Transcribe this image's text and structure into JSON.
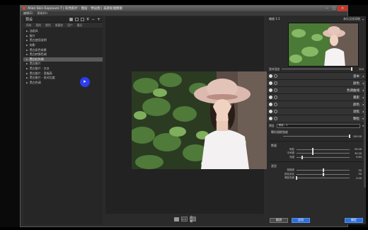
{
  "window": {
    "title": "Alien Skin Exposure 7 | 彩色胶片 - 图层 - 预设图 | 美颜处理模版"
  },
  "menubar": [
    "编辑(E)",
    "帮助(H)"
  ],
  "left_panel": {
    "title": "预设",
    "tabs": [
      "所有",
      "我的",
      "颜色",
      "收藏夹",
      "用户",
      "最近"
    ],
    "items": [
      {
        "label": "油画风",
        "selected": false
      },
      {
        "label": "胶片",
        "selected": false
      },
      {
        "label": "黑白使用说明",
        "selected": false
      },
      {
        "label": "电影",
        "selected": false
      },
      {
        "label": "黑白彩色效果",
        "selected": false
      },
      {
        "label": "黑白转换色调",
        "selected": false
      },
      {
        "label": "黑白红外线",
        "selected": true
      },
      {
        "label": "黑白胶片",
        "selected": false
      },
      {
        "label": "黑白胶片 - 交叉",
        "selected": false
      },
      {
        "label": "黑白胶片 - 宽幅高",
        "selected": false
      },
      {
        "label": "黑白胶片 - 低对比度",
        "selected": false
      },
      {
        "label": "黑白色调",
        "selected": false
      }
    ]
  },
  "center": {
    "zoom_button": "1:1",
    "compare_button": "之前"
  },
  "right_panel": {
    "zoom": "缩放 1:1",
    "preset_name": "永乐汉化导航",
    "overall_label": "整体强度",
    "overall_value": "100",
    "overall_fraction": 1.0,
    "sections": [
      {
        "label": "基本",
        "dot": "filled"
      },
      {
        "label": "颜色",
        "dot": "filled"
      },
      {
        "label": "色调曲线",
        "dot": "filled"
      },
      {
        "label": "暴影",
        "dot": "filled"
      },
      {
        "label": "颜色",
        "dot": "filled"
      },
      {
        "label": "调焦",
        "dot": "filled"
      },
      {
        "label": "颗粒",
        "dot": "filled"
      }
    ],
    "grain": {
      "preset_label": "预设",
      "preset_value": "预设 - 1",
      "strength_label": "颗粒粗糙强度",
      "strength_value": "100.00",
      "strength_fraction": 1.0,
      "amount_title": "数量",
      "amount_rows": [
        {
          "label": "阴影",
          "value": "30.00",
          "fraction": 0.3
        },
        {
          "label": "中间调",
          "value": "30.00",
          "fraction": 0.3
        },
        {
          "label": "亮度",
          "value": "9.84",
          "fraction": 0.1
        }
      ],
      "type_title": "类型",
      "type_rows": [
        {
          "label": "粗糙度",
          "value": "50",
          "fraction": 0.5
        },
        {
          "label": "颜色变化",
          "value": "50",
          "fraction": 0.5
        },
        {
          "label": "微距亮度",
          "value": "0.00",
          "fraction": 0.0
        }
      ]
    },
    "footer": {
      "cancel": "取消",
      "apply": "应用",
      "ok": "确定"
    }
  },
  "colors": {
    "accent": "#2e6fd8",
    "cursor": "#2d3df0"
  }
}
